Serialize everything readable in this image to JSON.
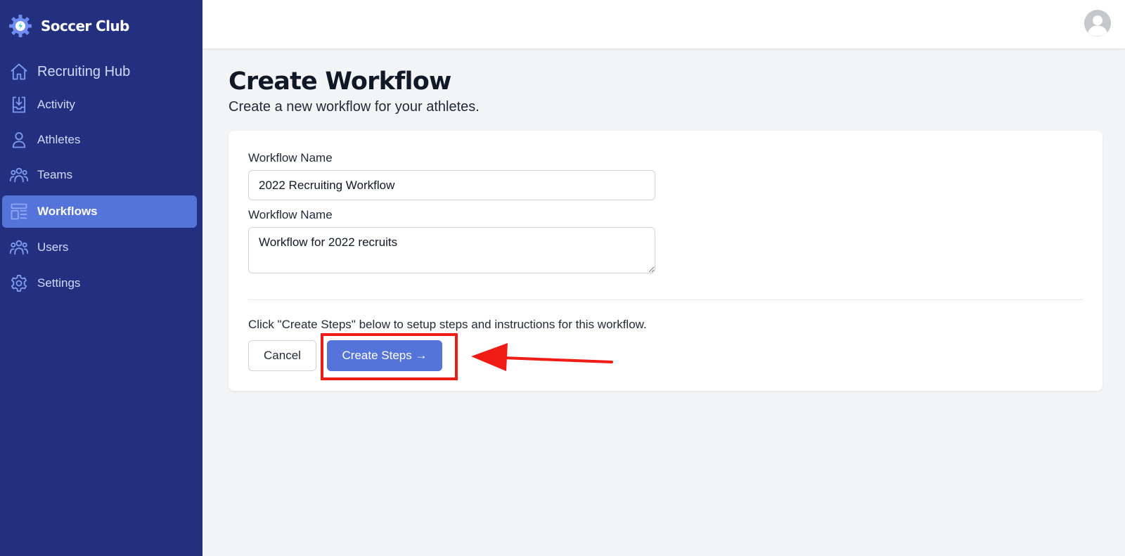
{
  "app": {
    "name": "Soccer Club"
  },
  "sidebar": {
    "items": [
      {
        "label": "Recruiting Hub",
        "icon": "home-icon"
      },
      {
        "label": "Activity",
        "icon": "inbox-download-icon"
      },
      {
        "label": "Athletes",
        "icon": "user-icon"
      },
      {
        "label": "Teams",
        "icon": "user-group-icon"
      },
      {
        "label": "Workflows",
        "icon": "template-icon",
        "active": true
      },
      {
        "label": "Users",
        "icon": "user-group-icon"
      },
      {
        "label": "Settings",
        "icon": "gear-icon"
      }
    ]
  },
  "header": {
    "avatar_icon": "user-avatar-icon"
  },
  "main": {
    "title": "Create Workflow",
    "subtitle": "Create a new workflow for your athletes.",
    "form": {
      "name_label": "Workflow Name",
      "name_value": "2022 Recruiting Workflow",
      "description_label": "Workflow Name",
      "description_value": "Workflow for 2022 recruits",
      "hint": "Click \"Create Steps\" below to setup steps and instructions for this workflow.",
      "cancel_label": "Cancel",
      "submit_label": "Create Steps →"
    }
  },
  "colors": {
    "sidebar_bg": "#22307f",
    "accent": "#5574d9",
    "annotation": "#ee1c14",
    "page_bg": "#f3f4f6"
  }
}
